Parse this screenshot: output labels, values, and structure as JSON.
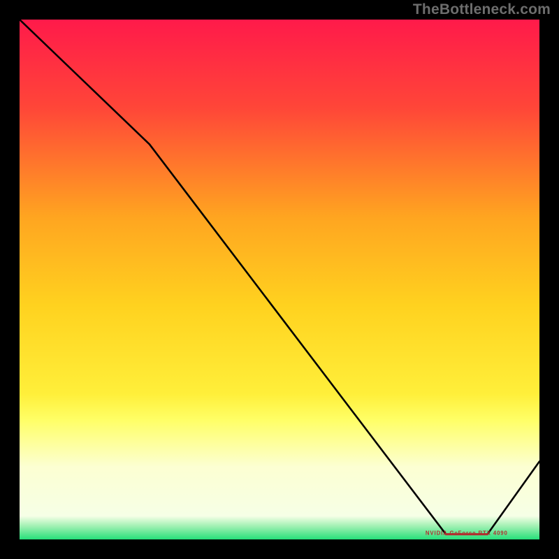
{
  "watermark": "TheBottleneck.com",
  "highlight_label": "NVIDIA GeForce RTX 4090",
  "colors": {
    "top": "#ff1a4a",
    "upper": "#ff6a2a",
    "mid": "#ffd21f",
    "lower_yellow": "#ffff66",
    "pale": "#fcffd2",
    "green": "#26e07a",
    "line": "#000000"
  },
  "chart_data": {
    "type": "line",
    "title": "",
    "xlabel": "",
    "ylabel": "",
    "xlim": [
      0,
      100
    ],
    "ylim": [
      0,
      100
    ],
    "x": [
      0,
      25,
      82,
      90,
      100
    ],
    "values": [
      100,
      76,
      1,
      1,
      15
    ],
    "highlight_segment": {
      "x0": 82,
      "x1": 90,
      "y": 1
    },
    "gradient_stops_pct": {
      "top_red": 0,
      "mid_yellow": 55,
      "pale_band_start": 77,
      "pale_band_end": 96,
      "green_end": 100
    }
  }
}
